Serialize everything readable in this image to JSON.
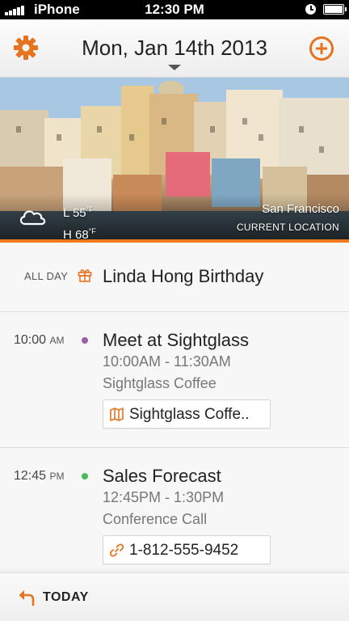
{
  "status_bar": {
    "carrier": "iPhone",
    "time": "12:30 PM"
  },
  "header": {
    "date": "Mon, Jan 14th 2013",
    "accent_color": "#e8731e"
  },
  "weather": {
    "low": "L 55",
    "high": "H 68",
    "unit": "°F",
    "icon": "cloud-icon",
    "city": "San Francisco",
    "location_label": "CURRENT LOCATION"
  },
  "all_day": {
    "label": "ALL DAY",
    "icon": "gift-icon",
    "title": "Linda Hong Birthday"
  },
  "events": [
    {
      "time": "10:00",
      "ampm": "AM",
      "dot_color": "#9b5fa8",
      "title": "Meet at Sightglass",
      "range": "10:00AM - 11:30AM",
      "where": "Sightglass Coffee",
      "chip_icon": "map-icon",
      "chip_text": "Sightglass Coffe.."
    },
    {
      "time": "12:45",
      "ampm": "PM",
      "dot_color": "#4cb85a",
      "title": "Sales Forecast",
      "range": "12:45PM - 1:30PM",
      "where": "Conference Call",
      "chip_icon": "link-icon",
      "chip_text": "1-812-555-9452"
    }
  ],
  "bottom_bar": {
    "today_label": "TODAY",
    "icon": "undo-arrow-icon"
  }
}
